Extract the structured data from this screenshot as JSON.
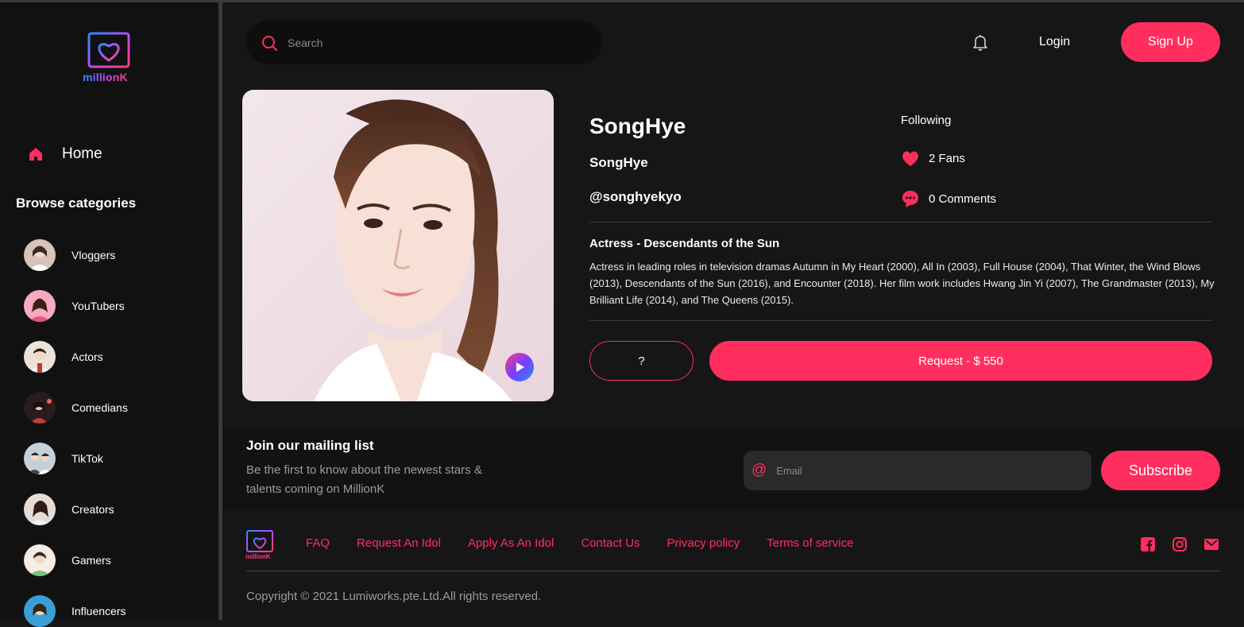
{
  "brand": {
    "name": "millionK"
  },
  "sidebar": {
    "home_label": "Home",
    "browse_title": "Browse categories",
    "categories": [
      {
        "label": "Vloggers",
        "avatar_color": "#d8c3b8"
      },
      {
        "label": "YouTubers",
        "avatar_color": "#f7a9c0"
      },
      {
        "label": "Actors",
        "avatar_color": "#e9d8c8"
      },
      {
        "label": "Comedians",
        "avatar_color": "#7a2a2a"
      },
      {
        "label": "TikTok",
        "avatar_color": "#b9c6d2"
      },
      {
        "label": "Creators",
        "avatar_color": "#d9cfc8"
      },
      {
        "label": "Gamers",
        "avatar_color": "#e7d6cc"
      },
      {
        "label": "Influencers",
        "avatar_color": "#4aa7d8"
      }
    ]
  },
  "header": {
    "search_placeholder": "Search",
    "login_label": "Login",
    "signup_label": "Sign Up"
  },
  "profile": {
    "name": "SongHye",
    "display_name": "SongHye",
    "handle": "@songhyekyo",
    "following_label": "Following",
    "fans_label": "2 Fans",
    "comments_label": "0 Comments",
    "bio_title": "Actress - Descendants of the Sun",
    "bio_text": "Actress in leading roles in television dramas Autumn in My Heart (2000), All In (2003), Full House (2004), That Winter, the Wind Blows (2013), Descendants of the Sun (2016), and Encounter (2018). Her film work includes Hwang Jin Yi (2007), The Grandmaster (2013), My Brilliant Life (2014), and The Queens (2015).",
    "question_label": "?",
    "request_label": "Request - $ 550"
  },
  "mailing": {
    "title": "Join our mailing list",
    "text": "Be the first to know about the newest stars & talents coming on MillionK",
    "email_placeholder": "Email",
    "subscribe_label": "Subscribe"
  },
  "footer": {
    "links": [
      "FAQ",
      "Request An Idol",
      "Apply As An Idol",
      "Contact Us",
      "Privacy policy",
      "Terms of service"
    ],
    "copyright": "Copyright © 2021 Lumiworks.pte.Ltd.All rights reserved."
  },
  "colors": {
    "accent": "#ff2e5e",
    "background": "#161616",
    "sidebar": "#111111"
  }
}
